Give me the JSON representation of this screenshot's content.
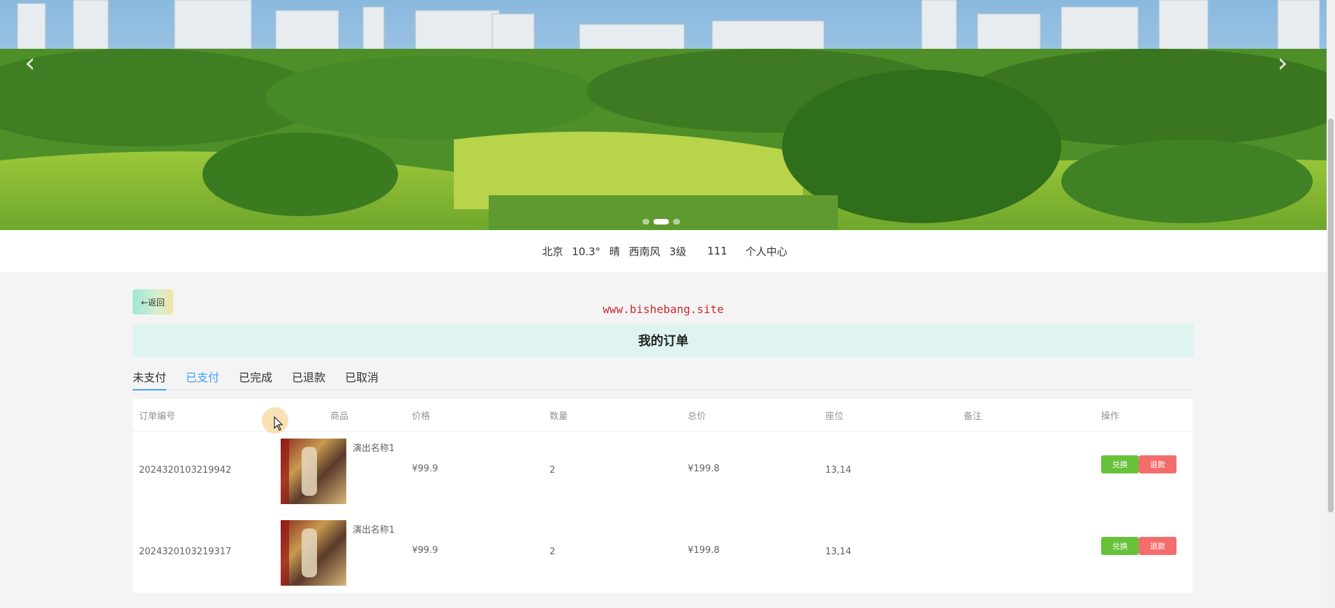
{
  "banner": {
    "arrow_left": "‹",
    "arrow_right": "›",
    "slides_count": 3,
    "active_slide": 2
  },
  "infobar": {
    "city": "北京",
    "temp": "10.3°",
    "weather": "晴",
    "wind": "西南风",
    "wind_level": "3级",
    "username": "111",
    "profile_label": "个人中心"
  },
  "back_label": "←返回",
  "watermark": "www.bishebang.site",
  "page_title": "我的订单",
  "tabs": [
    {
      "label": "未支付"
    },
    {
      "label": "已支付"
    },
    {
      "label": "已完成"
    },
    {
      "label": "已退款"
    },
    {
      "label": "已取消"
    }
  ],
  "table": {
    "headers": [
      "订单编号",
      "商品",
      "价格",
      "数量",
      "总价",
      "座位",
      "备注",
      "操作"
    ],
    "rows": [
      {
        "order_no": "2024320103219942",
        "product": "演出名称1",
        "price": "¥99.9",
        "qty": "2",
        "total": "¥199.8",
        "seat": "13,14",
        "note": "",
        "btn_redeem": "兑换",
        "btn_refund": "退款"
      },
      {
        "order_no": "2024320103219317",
        "product": "演出名称1",
        "price": "¥99.9",
        "qty": "2",
        "total": "¥199.8",
        "seat": "13,14",
        "note": "",
        "btn_redeem": "兑换",
        "btn_refund": "退款"
      }
    ]
  },
  "colors": {
    "title_bg": "#dff4f1",
    "watermark": "#cc2b2b",
    "redeem": "#67c23a",
    "refund": "#f56c6c",
    "tab_accent": "#409eff"
  }
}
